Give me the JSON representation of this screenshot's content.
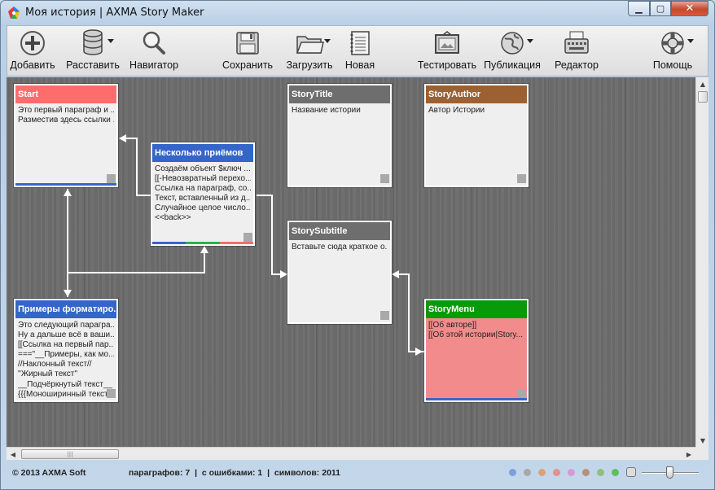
{
  "window": {
    "title": "Моя история | AXMA Story Maker",
    "min": "▁",
    "max": "▢",
    "close": "✕"
  },
  "toolbar": [
    {
      "id": "add",
      "label": "Добавить",
      "icon": "add-icon",
      "dropdown": false
    },
    {
      "id": "arrange",
      "label": "Расставить",
      "icon": "database-icon",
      "dropdown": true
    },
    {
      "id": "navigator",
      "label": "Навигатор",
      "icon": "magnifier-icon",
      "dropdown": false
    },
    {
      "id": "save",
      "label": "Сохранить",
      "icon": "floppy-icon",
      "dropdown": false
    },
    {
      "id": "load",
      "label": "Загрузить",
      "icon": "folder-icon",
      "dropdown": true
    },
    {
      "id": "new",
      "label": "Новая",
      "icon": "notebook-icon",
      "dropdown": false
    },
    {
      "id": "test",
      "label": "Тестировать",
      "icon": "picture-frame-icon",
      "dropdown": false
    },
    {
      "id": "publish",
      "label": "Публикация",
      "icon": "globe-icon",
      "dropdown": true
    },
    {
      "id": "editor",
      "label": "Редактор",
      "icon": "typewriter-icon",
      "dropdown": false
    },
    {
      "id": "help",
      "label": "Помощь",
      "icon": "lifebuoy-icon",
      "dropdown": true
    }
  ],
  "nodes": [
    {
      "id": "start",
      "title": "Start",
      "color": "#ff6c6c",
      "bg": "#efefef",
      "lines": [
        "Это первый параграф и ...",
        "Разместив здесь ссылки ..."
      ],
      "tags": [
        "#3c66c0"
      ]
    },
    {
      "id": "tricks",
      "title": "Несколько приёмов",
      "color": "#3565c8",
      "bg": "#efefef",
      "lines": [
        "Создаём объект $ключ ...",
        "[[-Невозвратный перехо...",
        "Ссылка на параграф, со...",
        "Текст, вставленный из д...",
        "Случайное целое число...",
        "<<back>>"
      ],
      "tags": [
        "#3c66c0",
        "#2fb24a",
        "#f07070"
      ]
    },
    {
      "id": "formatting",
      "title": "Примеры форматиро...",
      "color": "#3565c8",
      "bg": "#efefef",
      "lines": [
        "Это следующий парагра...",
        "Ну а дальше всё в ваши...",
        "[[Ссылка на первый пар...",
        "===\"__Примеры, как мо...",
        "//Наклонный текст//",
        "''Жирный текст''",
        "__Подчёркнутый текст__",
        "{{{Моноширинный текст..."
      ],
      "tags": []
    },
    {
      "id": "storytitle",
      "title": "StoryTitle",
      "color": "#6e6e6e",
      "bg": "#efefef",
      "lines": [
        "Название истории"
      ],
      "tags": []
    },
    {
      "id": "storysubtitle",
      "title": "StorySubtitle",
      "color": "#6e6e6e",
      "bg": "#efefef",
      "lines": [
        "Вставьте сюда краткое о..."
      ],
      "tags": []
    },
    {
      "id": "storyauthor",
      "title": "StoryAuthor",
      "color": "#9b6132",
      "bg": "#efefef",
      "lines": [
        "Автор Истории"
      ],
      "tags": []
    },
    {
      "id": "storymenu",
      "title": "StoryMenu",
      "color": "#089a08",
      "bg": "#f28c8c",
      "lines": [
        "[[Об авторе]]",
        "[[Об этой истории|Story..."
      ],
      "tags": [
        "#3c66c0"
      ]
    }
  ],
  "status": {
    "copyright": "© 2013 AXMA Soft",
    "counts": "параграфов: 7  |  с ошибками: 1  |  символов: 2011",
    "tag_colors": [
      "#7f9fd9",
      "#a8a8a8",
      "#d9a37a",
      "#e59090",
      "#d59ad5",
      "#b59075",
      "#8fbf7f",
      "#5fbf5f"
    ],
    "zoom_level": 0.5
  }
}
